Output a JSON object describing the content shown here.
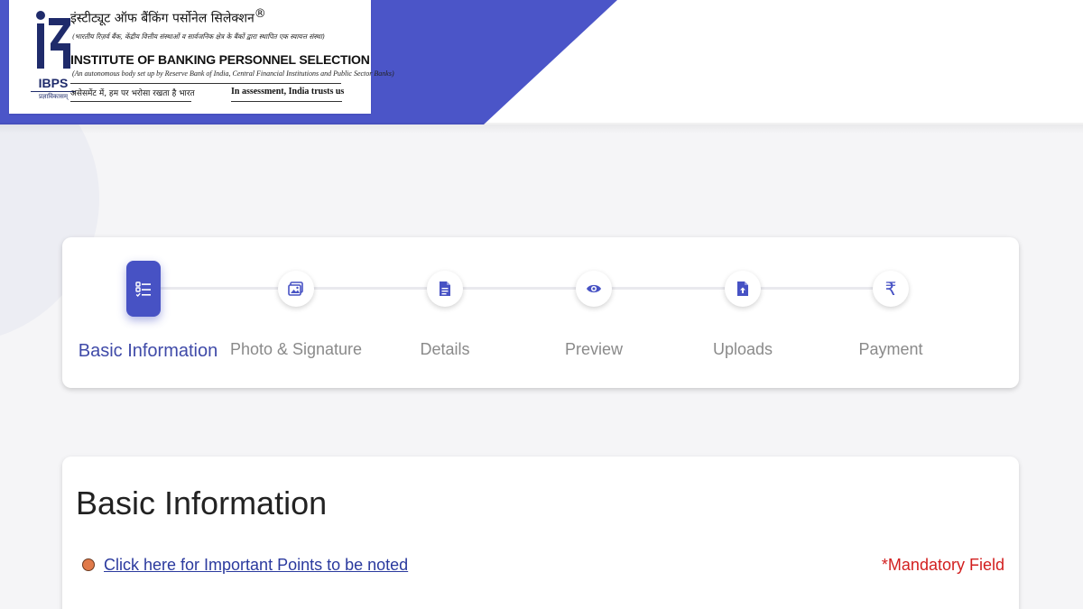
{
  "colors": {
    "brand_blue": "#4b55c8",
    "active_step": "#4752c4",
    "active_label": "#3f4aa8",
    "inactive_label": "#8a8a8a",
    "link": "#2b3a9e",
    "mandatory": "#d21f1f",
    "bullet": "#e07a4a"
  },
  "logo": {
    "mark_text": "IBPS",
    "mark_subtext": "प्रज्ञाविकासम्",
    "hindi_title": "इंस्टीट्यूट ऑफ बैंकिंग पर्सोनेल सिलेक्शन",
    "registered": "®",
    "hindi_subtitle": "(भारतीय रिज़र्व बैंक, केंद्रीय वित्तीय संस्थाओं व सार्वजनिक क्षेत्र के बैंकों द्वारा स्थापित एक स्वायत्त संस्था)",
    "english_title": "INSTITUTE OF BANKING PERSONNEL SELECTION",
    "english_subtitle": "(An autonomous body set up by Reserve Bank of India, Central Financial Institutions and Public Sector Banks)",
    "tagline_hindi": "असेसमेंट में, हम पर भरोसा रखता है भारत",
    "tagline_english": "In assessment, India trusts us"
  },
  "stepper": {
    "steps": [
      {
        "label": "Basic Information",
        "icon": "checklist-icon",
        "active": true
      },
      {
        "label": "Photo & Signature",
        "icon": "image-icon",
        "active": false
      },
      {
        "label": "Details",
        "icon": "document-icon",
        "active": false
      },
      {
        "label": "Preview",
        "icon": "eye-icon",
        "active": false
      },
      {
        "label": "Uploads",
        "icon": "file-upload-icon",
        "active": false
      },
      {
        "label": "Payment",
        "icon": "rupee-icon",
        "active": false
      }
    ],
    "rupee_symbol": "₹"
  },
  "basic_info": {
    "title": "Basic Information",
    "important_points_link": "Click here for Important Points to be noted",
    "mandatory_note": "*Mandatory Field"
  }
}
